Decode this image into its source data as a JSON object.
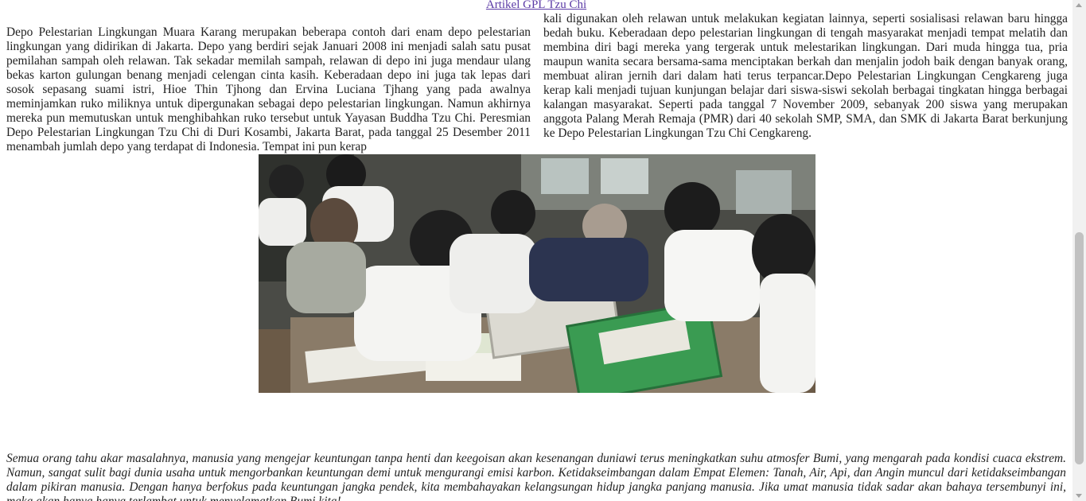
{
  "article": {
    "link_label": "Artikel GPL Tzu Chi",
    "left_column": "Depo Pelestarian Lingkungan Muara Karang merupakan beberapa contoh dari enam depo pelestarian lingkungan yang didirikan di Jakarta. Depo yang berdiri sejak Januari 2008 ini menjadi salah satu pusat pemilahan sampah oleh relawan. Tak sekadar memilah sampah, relawan di depo ini juga mendaur ulang bekas karton gulungan benang menjadi celengan cinta kasih. Keberadaan depo ini juga tak lepas dari sosok sepasang suami istri, Hioe Thin Tjhong dan Ervina Luciana Tjhang yang pada awalnya meminjamkan ruko miliknya untuk dipergunakan sebagai depo pelestarian lingkungan. Namun akhirnya mereka pun memutuskan untuk menghibahkan ruko tersebut untuk Yayasan Buddha Tzu Chi. Peresmian Depo Pelestarian Lingkungan Tzu Chi di Duri Kosambi, Jakarta Barat, pada tanggal 25 Desember 2011 menambah jumlah depo yang terdapat di Indonesia. Tempat ini pun kerap",
    "right_column": "kali digunakan oleh relawan untuk melakukan kegiatan lainnya, seperti sosialisasi relawan baru hingga bedah buku. Keberadaan depo pelestarian lingkungan di tengah masyarakat menjadi tempat melatih dan membina diri bagi mereka yang tergerak untuk melestarikan lingkungan. Dari muda hingga tua, pria maupun wanita secara bersama-sama menciptakan berkah dan menjalin jodoh baik dengan banyak orang, membuat aliran jernih dari dalam hati terus terpancar.Depo Pelestarian Lingkungan Cengkareng juga kerap kali menjadi tujuan kunjungan belajar dari siswa-siswi sekolah berbagai tingkatan hingga berbagai kalangan masyarakat. Seperti pada tanggal 7 November 2009, sebanyak 200 siswa yang merupakan anggota Palang Merah Remaja (PMR) dari 40 sekolah SMP, SMA, dan SMK di Jakarta Barat berkunjung ke Depo Pelestarian Lingkungan Tzu Chi Cengkareng.",
    "quote": "Semua orang tahu akar masalahnya, manusia yang mengejar keuntungan tanpa henti dan keegoisan akan kesenangan duniawi terus meningkatkan suhu atmosfer Bumi, yang mengarah pada kondisi cuaca ekstrem. Namun, sangat sulit bagi dunia usaha untuk mengorbankan keuntungan demi untuk mengurangi emisi karbon. Ketidakseimbangan dalam Empat Elemen: Tanah, Air, Api, dan Angin muncul dari ketidakseimbangan dalam pikiran manusia. Dengan hanya berfokus pada keuntungan jangka pendek, kita membahayakan kelangsungan hidup jangka panjang manusia. Jika umat manusia tidak sadar akan bahaya tersembunyi ini, maka akan hanya hanya terlambat untuk menyelamatkan Bumi kita!"
  },
  "photo": {
    "icon": "photo-students-sorting-paper"
  },
  "colors": {
    "link": "#5b3aa6",
    "text": "#222222",
    "scrollbar_track": "#f1f1f1",
    "scrollbar_thumb": "#c1c1c1"
  }
}
